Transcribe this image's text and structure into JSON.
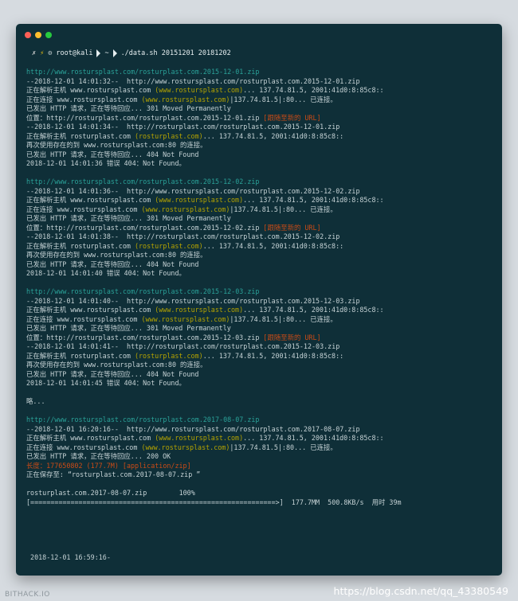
{
  "window_controls": [
    {
      "name": "close",
      "color": "#ff5f56"
    },
    {
      "name": "minimize",
      "color": "#ffbd2e"
    },
    {
      "name": "maximize",
      "color": "#27c93f"
    }
  ],
  "prompt": {
    "user": "root@kali",
    "dir": "~",
    "command": "./data.sh 20151201 20181202"
  },
  "lines": [
    [
      {
        "t": "http://www.rostursplast.com/rosturplast.com.2015-12-01.zip",
        "c": "url"
      }
    ],
    [
      {
        "t": "--2018-12-01 14:01:32--  http://www.rostursplast.com/rosturplast.com.2015-12-01.zip"
      }
    ],
    [
      {
        "t": "正在解析主机 www.rostursplast.com "
      },
      {
        "t": "(www.rostursplast.com)",
        "c": "y"
      },
      {
        "t": "... 137.74.81.5, 2001:41d0:8:85c8::"
      }
    ],
    [
      {
        "t": "正在连接 www.rostursplast.com "
      },
      {
        "t": "(www.rostursplast.com)",
        "c": "y"
      },
      {
        "t": "|137.74.81.5|:80... 已连接。"
      }
    ],
    [
      {
        "t": "已发出 HTTP 请求，正在等待回应... 301 Moved Permanently"
      }
    ],
    [
      {
        "t": "位置：http://rosturplast.com/rosturplast.com.2015-12-01.zip "
      },
      {
        "t": "[跟随至新的 URL]",
        "c": "o"
      }
    ],
    [
      {
        "t": "--2018-12-01 14:01:34--  http://rosturplast.com/rosturplast.com.2015-12-01.zip"
      }
    ],
    [
      {
        "t": "正在解析主机 rosturplast.com "
      },
      {
        "t": "(rosturplast.com)",
        "c": "y"
      },
      {
        "t": "... 137.74.81.5, 2001:41d0:8:85c8::"
      }
    ],
    [
      {
        "t": "再次使用存在的到 www.rostursplast.com:80 的连接。"
      }
    ],
    [
      {
        "t": "已发出 HTTP 请求，正在等待回应... 404 Not Found"
      }
    ],
    [
      {
        "t": "2018-12-01 14:01:36 错误 404：Not Found。"
      }
    ],
    [
      {
        "t": ""
      }
    ],
    [
      {
        "t": "http://www.rostursplast.com/rosturplast.com.2015-12-02.zip",
        "c": "url"
      }
    ],
    [
      {
        "t": "--2018-12-01 14:01:36--  http://www.rostursplast.com/rosturplast.com.2015-12-02.zip"
      }
    ],
    [
      {
        "t": "正在解析主机 www.rostursplast.com "
      },
      {
        "t": "(www.rostursplast.com)",
        "c": "y"
      },
      {
        "t": "... 137.74.81.5, 2001:41d0:8:85c8::"
      }
    ],
    [
      {
        "t": "正在连接 www.rostursplast.com "
      },
      {
        "t": "(www.rostursplast.com)",
        "c": "y"
      },
      {
        "t": "|137.74.81.5|:80... 已连接。"
      }
    ],
    [
      {
        "t": "已发出 HTTP 请求，正在等待回应... 301 Moved Permanently"
      }
    ],
    [
      {
        "t": "位置：http://rosturplast.com/rosturplast.com.2015-12-02.zip "
      },
      {
        "t": "[跟随至新的 URL]",
        "c": "o"
      }
    ],
    [
      {
        "t": "--2018-12-01 14:01:38--  http://rosturplast.com/rosturplast.com.2015-12-02.zip"
      }
    ],
    [
      {
        "t": "正在解析主机 rosturplast.com "
      },
      {
        "t": "(rosturplast.com)",
        "c": "y"
      },
      {
        "t": "... 137.74.81.5, 2001:41d0:8:85c8::"
      }
    ],
    [
      {
        "t": "再次使用存在的到 www.rostursplast.com:80 的连接。"
      }
    ],
    [
      {
        "t": "已发出 HTTP 请求，正在等待回应... 404 Not Found"
      }
    ],
    [
      {
        "t": "2018-12-01 14:01:40 错误 404：Not Found。"
      }
    ],
    [
      {
        "t": ""
      }
    ],
    [
      {
        "t": "http://www.rostursplast.com/rosturplast.com.2015-12-03.zip",
        "c": "url"
      }
    ],
    [
      {
        "t": "--2018-12-01 14:01:40--  http://www.rostursplast.com/rosturplast.com.2015-12-03.zip"
      }
    ],
    [
      {
        "t": "正在解析主机 www.rostursplast.com "
      },
      {
        "t": "(www.rostursplast.com)",
        "c": "y"
      },
      {
        "t": "... 137.74.81.5, 2001:41d0:8:85c8::"
      }
    ],
    [
      {
        "t": "正在连接 www.rostursplast.com "
      },
      {
        "t": "(www.rostursplast.com)",
        "c": "y"
      },
      {
        "t": "|137.74.81.5|:80... 已连接。"
      }
    ],
    [
      {
        "t": "已发出 HTTP 请求，正在等待回应... 301 Moved Permanently"
      }
    ],
    [
      {
        "t": "位置：http://rosturplast.com/rosturplast.com.2015-12-03.zip "
      },
      {
        "t": "[跟随至新的 URL]",
        "c": "o"
      }
    ],
    [
      {
        "t": "--2018-12-01 14:01:41--  http://rosturplast.com/rosturplast.com.2015-12-03.zip"
      }
    ],
    [
      {
        "t": "正在解析主机 rosturplast.com "
      },
      {
        "t": "(rosturplast.com)",
        "c": "y"
      },
      {
        "t": "... 137.74.81.5, 2001:41d0:8:85c8::"
      }
    ],
    [
      {
        "t": "再次使用存在的到 www.rostursplast.com:80 的连接。"
      }
    ],
    [
      {
        "t": "已发出 HTTP 请求，正在等待回应... 404 Not Found"
      }
    ],
    [
      {
        "t": "2018-12-01 14:01:45 错误 404：Not Found。"
      }
    ],
    [
      {
        "t": ""
      }
    ],
    [
      {
        "t": "略..."
      }
    ],
    [
      {
        "t": ""
      }
    ],
    [
      {
        "t": "http://www.rostursplast.com/rosturplast.com.2017-08-07.zip",
        "c": "url"
      }
    ],
    [
      {
        "t": "--2018-12-01 16:20:16--  http://www.rostursplast.com/rosturplast.com.2017-08-07.zip"
      }
    ],
    [
      {
        "t": "正在解析主机 www.rostursplast.com "
      },
      {
        "t": "(www.rostursplast.com)",
        "c": "y"
      },
      {
        "t": "... 137.74.81.5, 2001:41d0:8:85c8::"
      }
    ],
    [
      {
        "t": "正在连接 www.rostursplast.com "
      },
      {
        "t": "(www.rostursplast.com)",
        "c": "y"
      },
      {
        "t": "|137.74.81.5|:80... 已连接。"
      }
    ],
    [
      {
        "t": "已发出 HTTP 请求，正在等待回应... 200 OK"
      }
    ],
    [
      {
        "t": "长度：177650802 (177.7M) [application/zip]",
        "c": "o"
      }
    ],
    [
      {
        "t": "正在保存至: “rosturplast.com.2017-08-07.zip ”"
      }
    ],
    [
      {
        "t": ""
      }
    ],
    [
      {
        "t": "rosturplast.com.2017-08-07.zip        100%"
      }
    ],
    [
      {
        "t": "[=============================================================>]  177.7MM  500.8KB/s  用时 39m"
      }
    ],
    [
      {
        "t": ""
      }
    ],
    [
      {
        "t": ""
      }
    ],
    [
      {
        "t": ""
      }
    ],
    [
      {
        "t": ""
      }
    ],
    [
      {
        "t": ""
      }
    ],
    [
      {
        "t": " 2018-12-01 16:59:16-"
      }
    ]
  ],
  "watermark": {
    "left": "BITHACK.IO",
    "right": "https://blog.csdn.net/qq_43380549"
  }
}
